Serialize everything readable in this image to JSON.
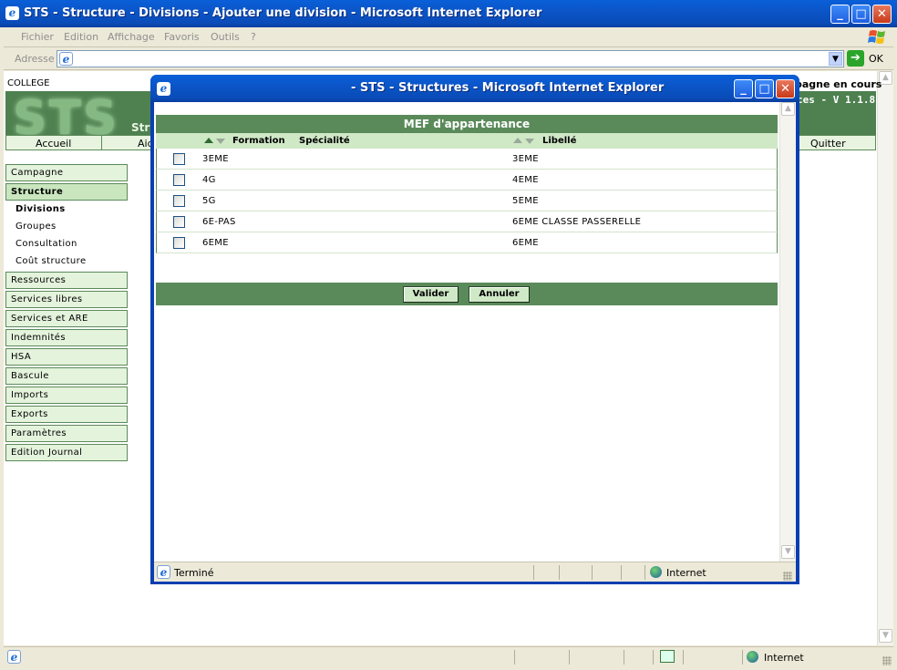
{
  "main_window": {
    "title": "STS - Structure - Divisions - Ajouter une division - Microsoft Internet Explorer",
    "menu": [
      "Fichier",
      "Edition",
      "Affichage",
      "Favoris",
      "Outils",
      "?"
    ],
    "address_label": "Adresse",
    "go_label": "OK",
    "status_zone": "Internet"
  },
  "app": {
    "college_label": "COLLEGE",
    "campagne": "pagne en cours",
    "logo": "STS",
    "banner_sub": "Str",
    "version": "ces - V 1.1.8",
    "topnav": [
      "Accueil",
      "Aid",
      "Quitter"
    ],
    "sidebar": {
      "campagne": "Campagne",
      "structure": "Structure",
      "sub_items": [
        "Divisions",
        "Groupes",
        "Consultation",
        "Coût structure"
      ],
      "items": [
        "Ressources",
        "Services libres",
        "Services et ARE",
        "Indemnités",
        "HSA",
        "Bascule",
        "Imports",
        "Exports",
        "Paramètres",
        "Edition Journal"
      ]
    }
  },
  "popup": {
    "title": "- STS - Structures - Microsoft Internet Explorer",
    "heading": "MEF d'appartenance",
    "columns": {
      "formation": "Formation",
      "specialite": "Spécialité",
      "libelle": "Libellé"
    },
    "rows": [
      {
        "code": "3EME",
        "libelle": "3EME"
      },
      {
        "code": "4G",
        "libelle": "4EME"
      },
      {
        "code": "5G",
        "libelle": "5EME"
      },
      {
        "code": "6E-PAS",
        "libelle": "6EME CLASSE PASSERELLE"
      },
      {
        "code": "6EME",
        "libelle": "6EME"
      }
    ],
    "buttons": {
      "validate": "Valider",
      "cancel": "Annuler"
    },
    "status_text": "Terminé",
    "status_zone": "Internet"
  },
  "colors": {
    "accent_green": "#5a8a5a",
    "xp_blue": "#0a55c8"
  }
}
